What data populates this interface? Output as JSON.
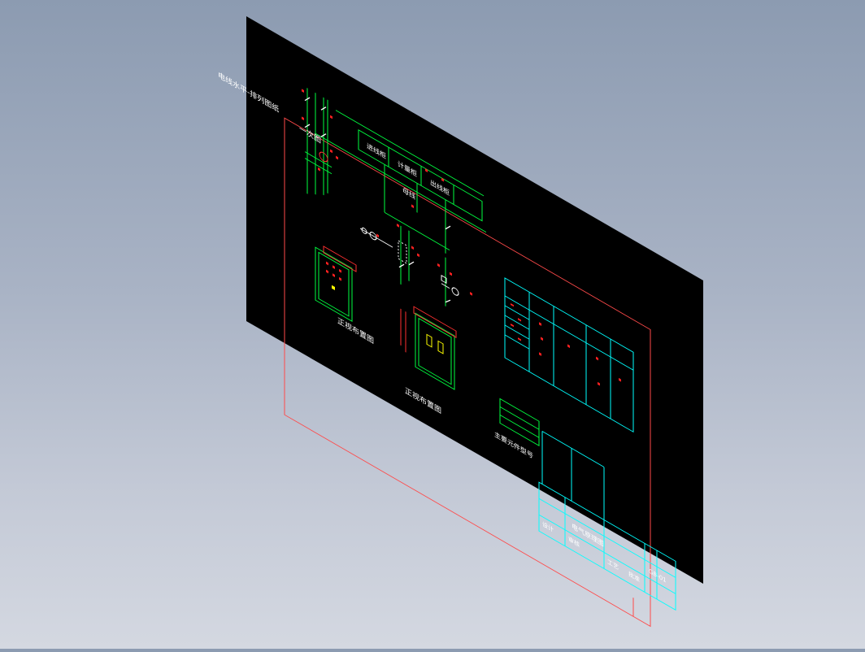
{
  "colors": {
    "background_top": "#8c9bb1",
    "background_bottom": "#d4d8e1",
    "sheet": "#000000",
    "frame": "#ff4a4a",
    "table": "#00ffff",
    "wiring": "#00ff40",
    "symbol": "#ffffff",
    "tag": "#ff2020",
    "note": "#ffff00"
  },
  "drawing": {
    "title_left": "电线水平-排列图纸",
    "subtitle_left": "一次图",
    "bus_headers": [
      "进线柜",
      "计量柜",
      "出线柜"
    ],
    "bus_label": "母线",
    "box_label_left": "正视布置图",
    "box_label_right": "正视布置图",
    "vertical_note": "主要元件型号",
    "title_block_name": "电气原理图",
    "title_block_labels": [
      "设计",
      "审核",
      "工艺",
      "批准"
    ],
    "drawing_number": "GB-01"
  }
}
